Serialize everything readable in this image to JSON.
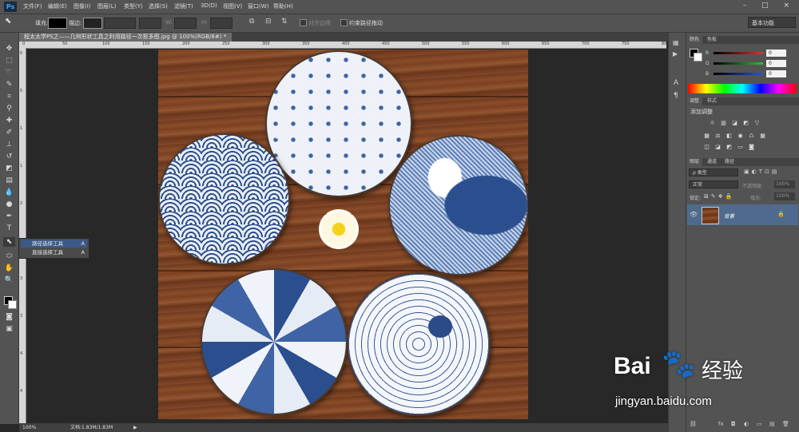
{
  "app": {
    "logo": "Ps"
  },
  "menu": [
    "文件(F)",
    "编辑(E)",
    "图像(I)",
    "图层(L)",
    "类型(Y)",
    "选择(S)",
    "滤镜(T)",
    "3D(D)",
    "视图(V)",
    "窗口(W)",
    "帮助(H)"
  ],
  "window_controls": "– □ ×",
  "options": {
    "fill_label": "填充:",
    "stroke_label": "描边:",
    "w_label": "W:",
    "h_label": "H:",
    "align_edges": "对齐边缘",
    "constrain_path": "约束路径拖动",
    "workspace": "基本功能"
  },
  "document": {
    "tab_title": "程太太学PS之——几何形状工具之利用路径一次抠多图.jpg @ 100%(RGB/8#) *",
    "tab_close": "×",
    "zoom": "100%",
    "doc_info": "文档:1.83M/1.83M"
  },
  "ruler": {
    "top": [
      "0",
      "50",
      "100",
      "150",
      "200",
      "250",
      "300",
      "350",
      "400",
      "450",
      "500",
      "550",
      "600",
      "650",
      "700",
      "750",
      "800"
    ],
    "left": [
      "0",
      "5",
      "1",
      "1",
      "2",
      "2",
      "3",
      "3",
      "4",
      "4",
      "5"
    ]
  },
  "flyout": {
    "items": [
      {
        "label": "路径选择工具",
        "key": "A"
      },
      {
        "label": "直接选择工具",
        "key": "A"
      }
    ]
  },
  "color_panel": {
    "tabs": [
      "颜色",
      "色板"
    ],
    "channels": [
      {
        "name": "R",
        "value": "0",
        "color": "#e03030"
      },
      {
        "name": "G",
        "value": "0",
        "color": "#30c030"
      },
      {
        "name": "B",
        "value": "0",
        "color": "#3050e0"
      }
    ]
  },
  "adjustments_panel": {
    "tabs": [
      "调整",
      "样式"
    ],
    "title": "添加调整"
  },
  "layers_panel": {
    "tabs": [
      "图层",
      "通道",
      "路径"
    ],
    "kind": "类型",
    "blend_mode": "正常",
    "opacity_label": "不透明度:",
    "opacity_value": "100%",
    "lock_label": "锁定:",
    "fill_label": "填充:",
    "fill_value": "100%",
    "layer_name": "背景"
  },
  "panel_footer": [
    "fx",
    "◘",
    "◐",
    "▭",
    "▤",
    "🗑"
  ],
  "watermark": {
    "brand": "Bai",
    "brand2": "经验",
    "url": "jingyan.baidu.com"
  },
  "colors": {
    "accent_layer": "#4f6a8e",
    "ui_gray": "#535353",
    "dark": "#282828"
  }
}
